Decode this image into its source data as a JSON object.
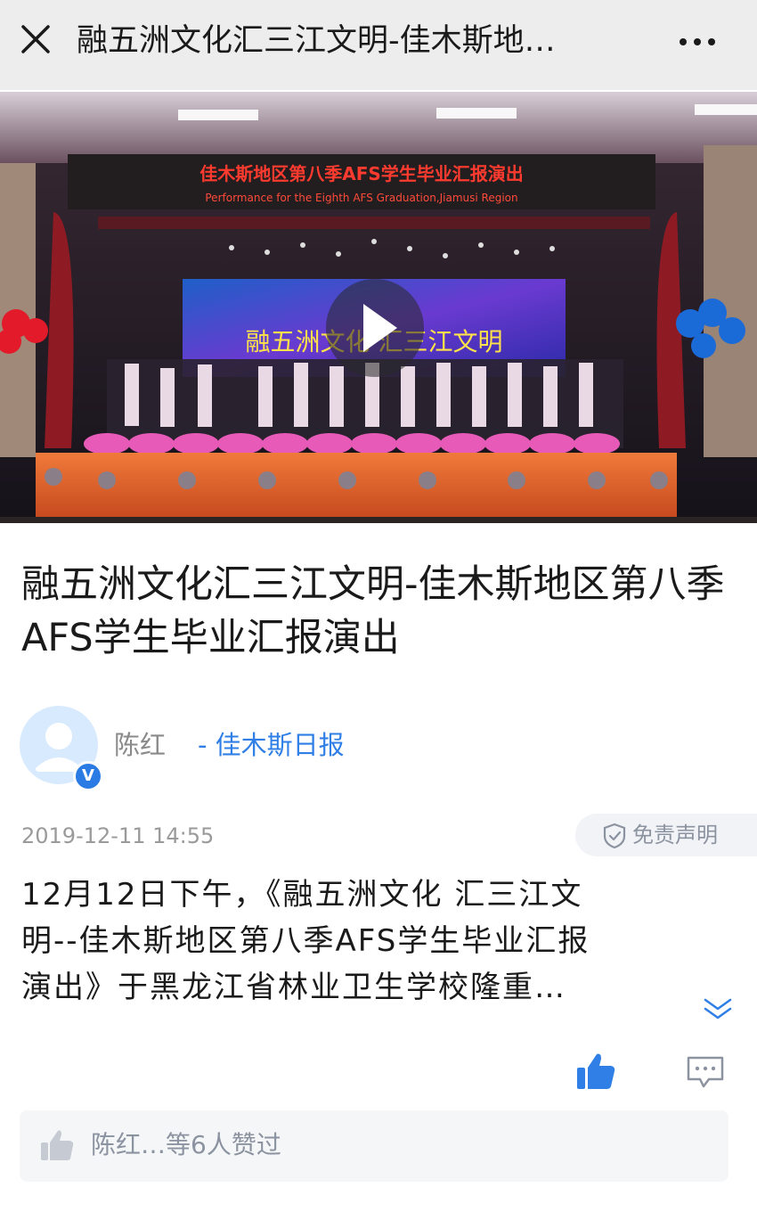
{
  "topbar": {
    "title": "融五洲文化汇三江文明-佳木斯地…",
    "close_icon": "close-icon",
    "more_icon": "more-horizontal-icon"
  },
  "video": {
    "banner_cn": "佳木斯地区第八季AFS学生毕业汇报演出",
    "banner_en": "Performance for the Eighth AFS Graduation,Jiamusi Region",
    "screen_text": "融五洲文化 汇三江文明",
    "play_icon": "play-icon"
  },
  "article": {
    "title": "融五洲文化汇三江文明-佳木斯地区第八季AFS学生毕业汇报演出",
    "author": "陈红",
    "source": " - 佳木斯日报",
    "verified_badge": "V",
    "date": "2019-12-11 14:55",
    "disclaimer": "免责声明",
    "body_lines": [
      "12月12日下午，《融五洲文化 汇三江文",
      "明--佳木斯地区第八季AFS学生毕业汇报",
      "演出》于黑龙江省林业卫生学校隆重…"
    ]
  },
  "actions": {
    "like_icon": "thumbs-up-icon",
    "comment_icon": "comment-icon",
    "likes_summary": "陈红…等6人赞过"
  },
  "colors": {
    "accent": "#2f7fe6",
    "topbar_bg": "#ededed",
    "muted_text": "#8c93a0"
  }
}
